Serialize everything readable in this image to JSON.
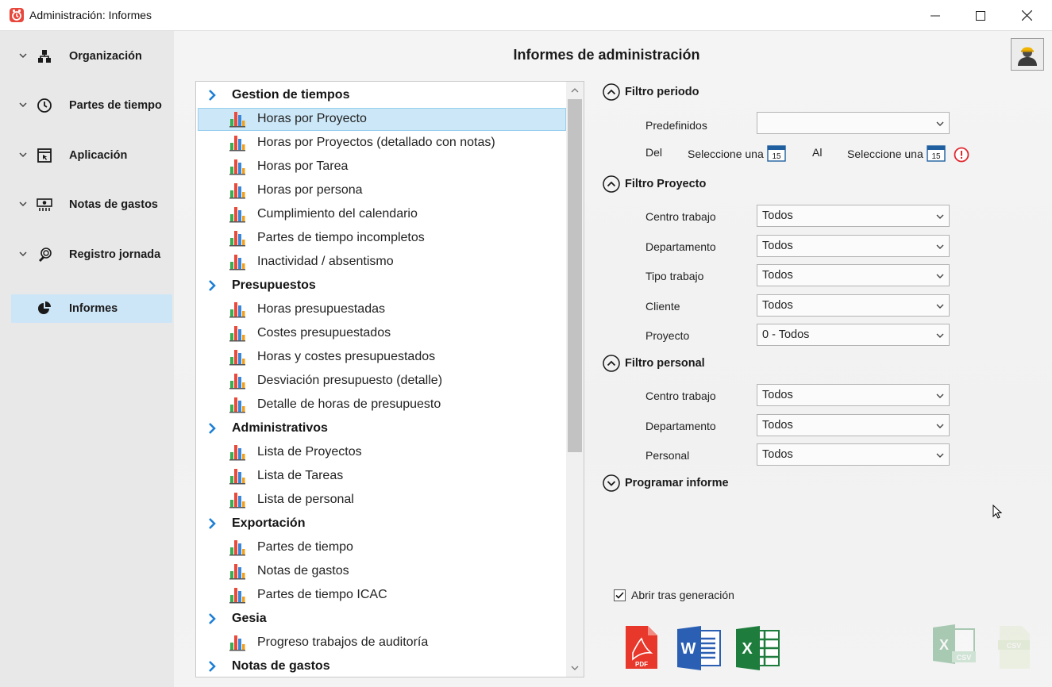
{
  "window": {
    "title": "Administración: Informes"
  },
  "sidebar": {
    "items": [
      {
        "label": "Organización",
        "icon": "hierarchy-icon",
        "active": false
      },
      {
        "label": "Partes de tiempo",
        "icon": "clock-icon",
        "active": false
      },
      {
        "label": "Aplicación",
        "icon": "window-cursor-icon",
        "active": false
      },
      {
        "label": "Notas de gastos",
        "icon": "money-icon",
        "active": false
      },
      {
        "label": "Registro jornada",
        "icon": "fingerprint-icon",
        "active": false
      },
      {
        "label": "Informes",
        "icon": "pie-chart-icon",
        "active": true
      }
    ]
  },
  "main": {
    "title": "Informes de administración",
    "user_button_icon": "worker-avatar-icon"
  },
  "tree": {
    "rows": [
      {
        "type": "category",
        "label": "Gestion de tiempos"
      },
      {
        "type": "item",
        "label": "Horas por Proyecto",
        "selected": true
      },
      {
        "type": "item",
        "label": "Horas por Proyectos (detallado con notas)"
      },
      {
        "type": "item",
        "label": "Horas por Tarea"
      },
      {
        "type": "item",
        "label": "Horas por persona"
      },
      {
        "type": "item",
        "label": "Cumplimiento del calendario"
      },
      {
        "type": "item",
        "label": "Partes de tiempo incompletos"
      },
      {
        "type": "item",
        "label": "Inactividad / absentismo"
      },
      {
        "type": "category",
        "label": "Presupuestos"
      },
      {
        "type": "item",
        "label": "Horas presupuestadas"
      },
      {
        "type": "item",
        "label": "Costes presupuestados"
      },
      {
        "type": "item",
        "label": "Horas y costes presupuestados"
      },
      {
        "type": "item",
        "label": "Desviación presupuesto (detalle)"
      },
      {
        "type": "item",
        "label": "Detalle de horas de presupuesto"
      },
      {
        "type": "category",
        "label": "Administrativos"
      },
      {
        "type": "item",
        "label": "Lista de Proyectos"
      },
      {
        "type": "item",
        "label": "Lista de Tareas"
      },
      {
        "type": "item",
        "label": "Lista de personal"
      },
      {
        "type": "category",
        "label": "Exportación"
      },
      {
        "type": "item",
        "label": "Partes de tiempo"
      },
      {
        "type": "item",
        "label": "Notas de gastos"
      },
      {
        "type": "item",
        "label": "Partes de tiempo ICAC"
      },
      {
        "type": "category",
        "label": "Gesia"
      },
      {
        "type": "item",
        "label": "Progreso trabajos de auditoría"
      },
      {
        "type": "category",
        "label": "Notas de gastos"
      }
    ]
  },
  "filters": {
    "periodo": {
      "title": "Filtro periodo",
      "predefinidos_label": "Predefinidos",
      "predefinidos_value": "",
      "del_label": "Del",
      "del_value": "Seleccione una",
      "al_label": "Al",
      "al_value": "Seleccione una",
      "calendar_day": "15"
    },
    "proyecto": {
      "title": "Filtro Proyecto",
      "fields": [
        {
          "label": "Centro trabajo",
          "value": "Todos"
        },
        {
          "label": "Departamento",
          "value": "Todos"
        },
        {
          "label": "Tipo trabajo",
          "value": "Todos"
        },
        {
          "label": "Cliente",
          "value": "Todos"
        },
        {
          "label": "Proyecto",
          "value": "0 - Todos"
        }
      ]
    },
    "personal": {
      "title": "Filtro personal",
      "fields": [
        {
          "label": "Centro trabajo",
          "value": "Todos"
        },
        {
          "label": "Departamento",
          "value": "Todos"
        },
        {
          "label": "Personal",
          "value": "Todos"
        }
      ]
    },
    "programar": {
      "title": "Programar informe"
    }
  },
  "options": {
    "open_after_label": "Abrir tras generación",
    "open_after_checked": true
  },
  "export": {
    "pdf_text": "PDF",
    "word_text": "W",
    "excel_text": "X",
    "excel_csv_text": "CSV",
    "csv_text": "CSV"
  },
  "colors": {
    "sidebar_bg": "#e8e8e8",
    "active_nav": "#cde6f7",
    "selection": "#cce8f8",
    "chevron_blue": "#1d7fd6",
    "warning_red": "#e0282f"
  }
}
